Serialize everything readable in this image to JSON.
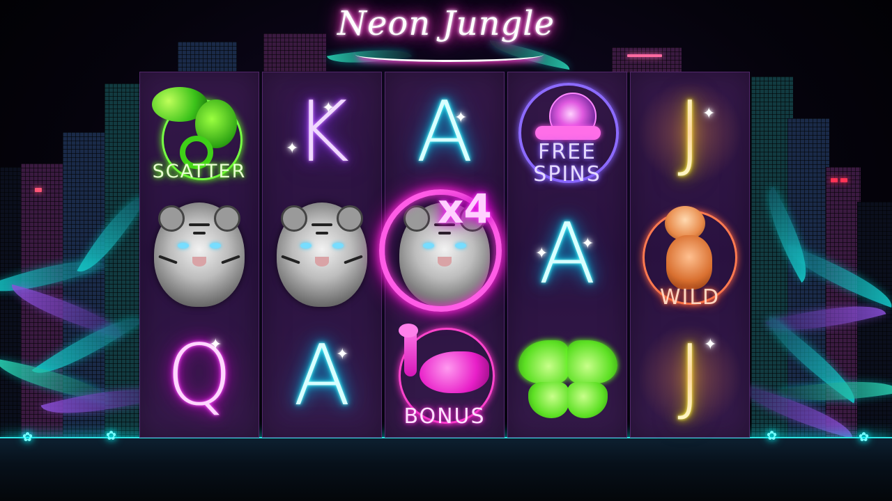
{
  "game": {
    "title": "Neon Jungle"
  },
  "reels": [
    {
      "symbols": [
        {
          "name": "chameleon-scatter",
          "label": "SCATTER"
        },
        {
          "name": "white-tiger",
          "label": ""
        },
        {
          "name": "letter-q",
          "label": "Q"
        }
      ]
    },
    {
      "symbols": [
        {
          "name": "letter-k",
          "label": "K"
        },
        {
          "name": "white-tiger",
          "label": ""
        },
        {
          "name": "letter-a",
          "label": "A"
        }
      ]
    },
    {
      "symbols": [
        {
          "name": "letter-a",
          "label": "A"
        },
        {
          "name": "white-tiger-multiplier",
          "label": "x4"
        },
        {
          "name": "flamingo-bonus",
          "label": "BONUS"
        }
      ]
    },
    {
      "symbols": [
        {
          "name": "snail-free-spins",
          "label_line1": "FREE",
          "label_line2": "SPINS"
        },
        {
          "name": "letter-a",
          "label": "A"
        },
        {
          "name": "butterfly",
          "label": ""
        }
      ]
    },
    {
      "symbols": [
        {
          "name": "letter-j",
          "label": "J"
        },
        {
          "name": "monkey-wild",
          "label": "WILD"
        },
        {
          "name": "letter-j",
          "label": "J"
        }
      ]
    }
  ],
  "colors": {
    "neon_cyan": "#00e5ff",
    "neon_pink": "#ff2fd0",
    "neon_purple": "#b060ff",
    "neon_yellow": "#ffff40",
    "reel_bg": "#2e1442"
  }
}
